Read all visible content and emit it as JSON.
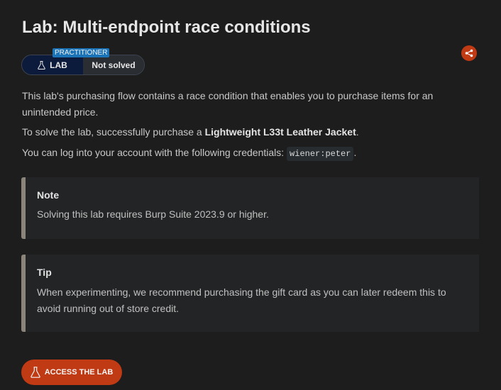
{
  "title": "Lab: Multi-endpoint race conditions",
  "badge": {
    "level": "PRACTITIONER",
    "lab_label": "LAB",
    "status": "Not solved"
  },
  "description": {
    "p1": "This lab's purchasing flow contains a race condition that enables you to purchase items for an unintended price.",
    "p2_prefix": "To solve the lab, successfully purchase a ",
    "p2_bold": "Lightweight L33t Leather Jacket",
    "p2_suffix": ".",
    "p3_prefix": "You can log into your account with the following credentials: ",
    "p3_code": "wiener:peter",
    "p3_suffix": "."
  },
  "note": {
    "title": "Note",
    "body": "Solving this lab requires Burp Suite 2023.9 or higher."
  },
  "tip": {
    "title": "Tip",
    "body": "When experimenting, we recommend purchasing the gift card as you can later redeem this to avoid running out of store credit."
  },
  "access_button": {
    "label": "ACCESS THE LAB"
  },
  "icons": {
    "share": "share-icon",
    "flask": "flask-icon"
  },
  "colors": {
    "background": "#1d1d1d",
    "accent_orange": "#c03a14",
    "badge_blue": "#0c1b3b",
    "level_blue": "#1c74b8"
  }
}
